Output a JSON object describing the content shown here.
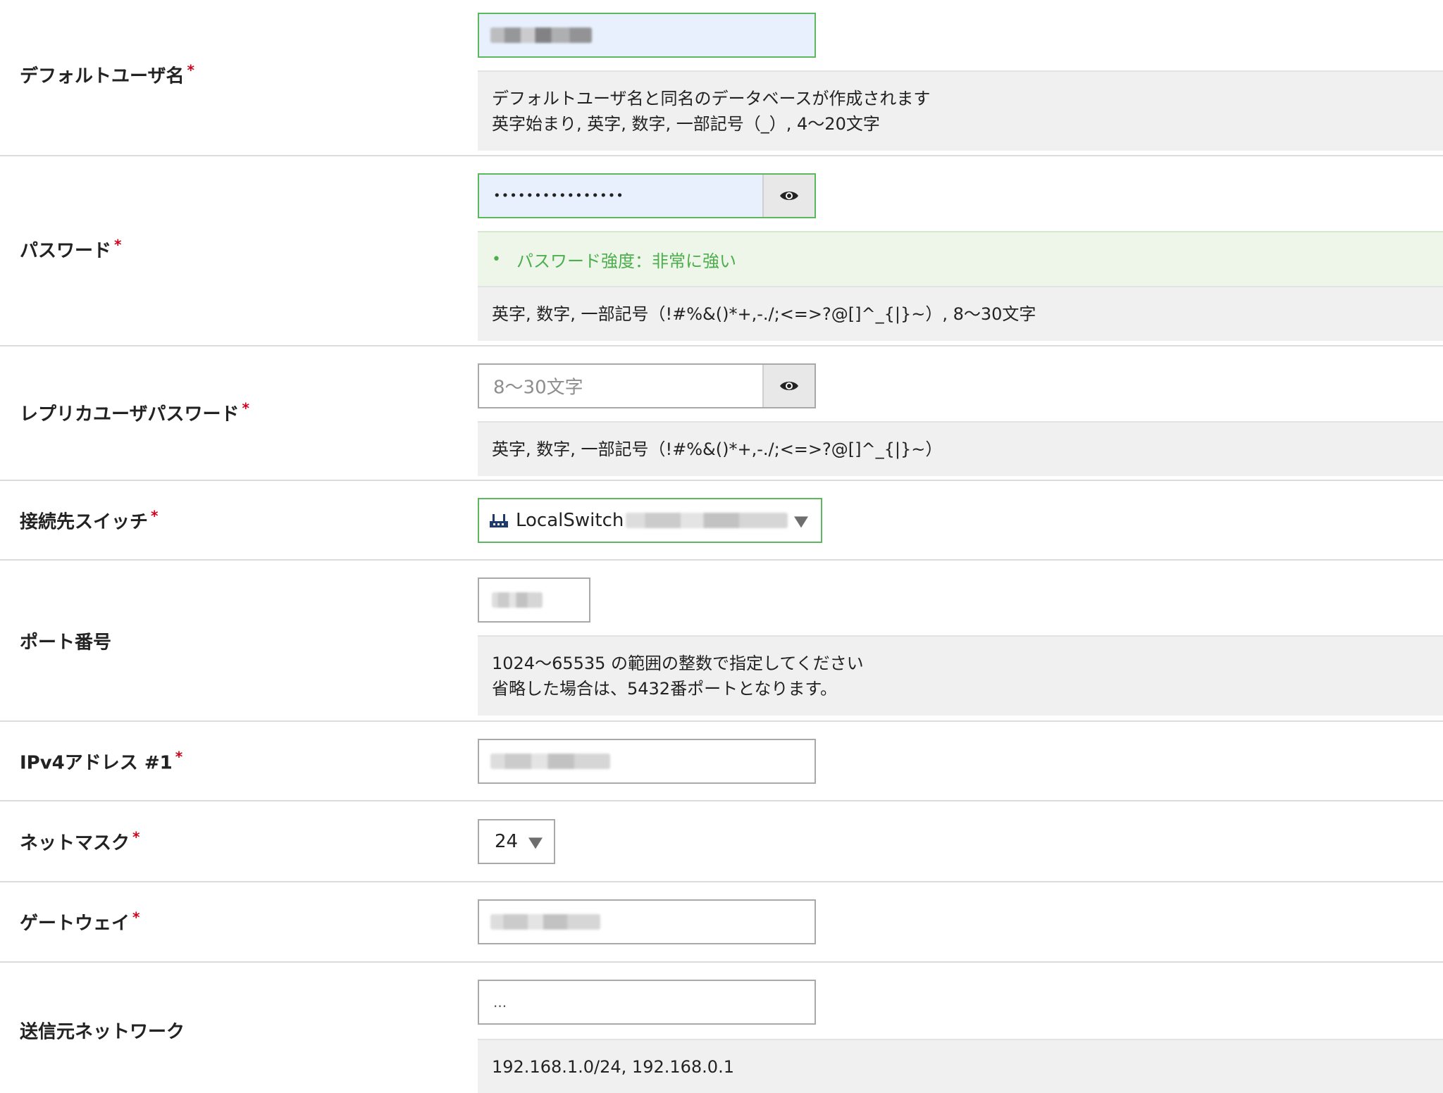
{
  "fields": {
    "default_user": {
      "label": "デフォルトユーザ名",
      "required_mark": "*",
      "help_line1": "デフォルトユーザ名と同名のデータベースが作成されます",
      "help_line2": "英字始まり, 英字, 数字, 一部記号（_）, 4〜20文字"
    },
    "password": {
      "label": "パスワード",
      "required_mark": "*",
      "value": "••••••••••••••••",
      "strength_bullet": "•",
      "strength": "パスワード強度：非常に強い",
      "help": "英字, 数字, 一部記号（!#%&()*+,-./;<=>?@[]^_{|}~）, 8〜30文字",
      "toggle_icon": "eye-icon"
    },
    "replica_password": {
      "label": "レプリカユーザパスワード",
      "required_mark": "*",
      "placeholder": "8〜30文字",
      "help": "英字, 数字, 一部記号（!#%&()*+,-./;<=>?@[]^_{|}~）",
      "toggle_icon": "eye-icon"
    },
    "switch": {
      "label": "接続先スイッチ",
      "required_mark": "*",
      "value": "LocalSwitch",
      "icon": "switch-icon"
    },
    "port": {
      "label": "ポート番号",
      "help_line1": "1024〜65535 の範囲の整数で指定してください",
      "help_line2": "省略した場合は、5432番ポートとなります。"
    },
    "ipv4": {
      "label": "IPv4アドレス #1",
      "required_mark": "*"
    },
    "netmask": {
      "label": "ネットマスク",
      "required_mark": "*",
      "value": "24"
    },
    "gateway": {
      "label": "ゲートウェイ",
      "required_mark": "*"
    },
    "source_network": {
      "label": "送信元ネットワーク",
      "value": "...",
      "help": "192.168.1.0/24, 192.168.0.1"
    }
  },
  "colors": {
    "valid_border": "#5cb85c",
    "autofill_bg": "#e8f0fe",
    "required": "#d0021b",
    "strength_text": "#4cae4c",
    "help_bg": "#f0f0f0"
  }
}
